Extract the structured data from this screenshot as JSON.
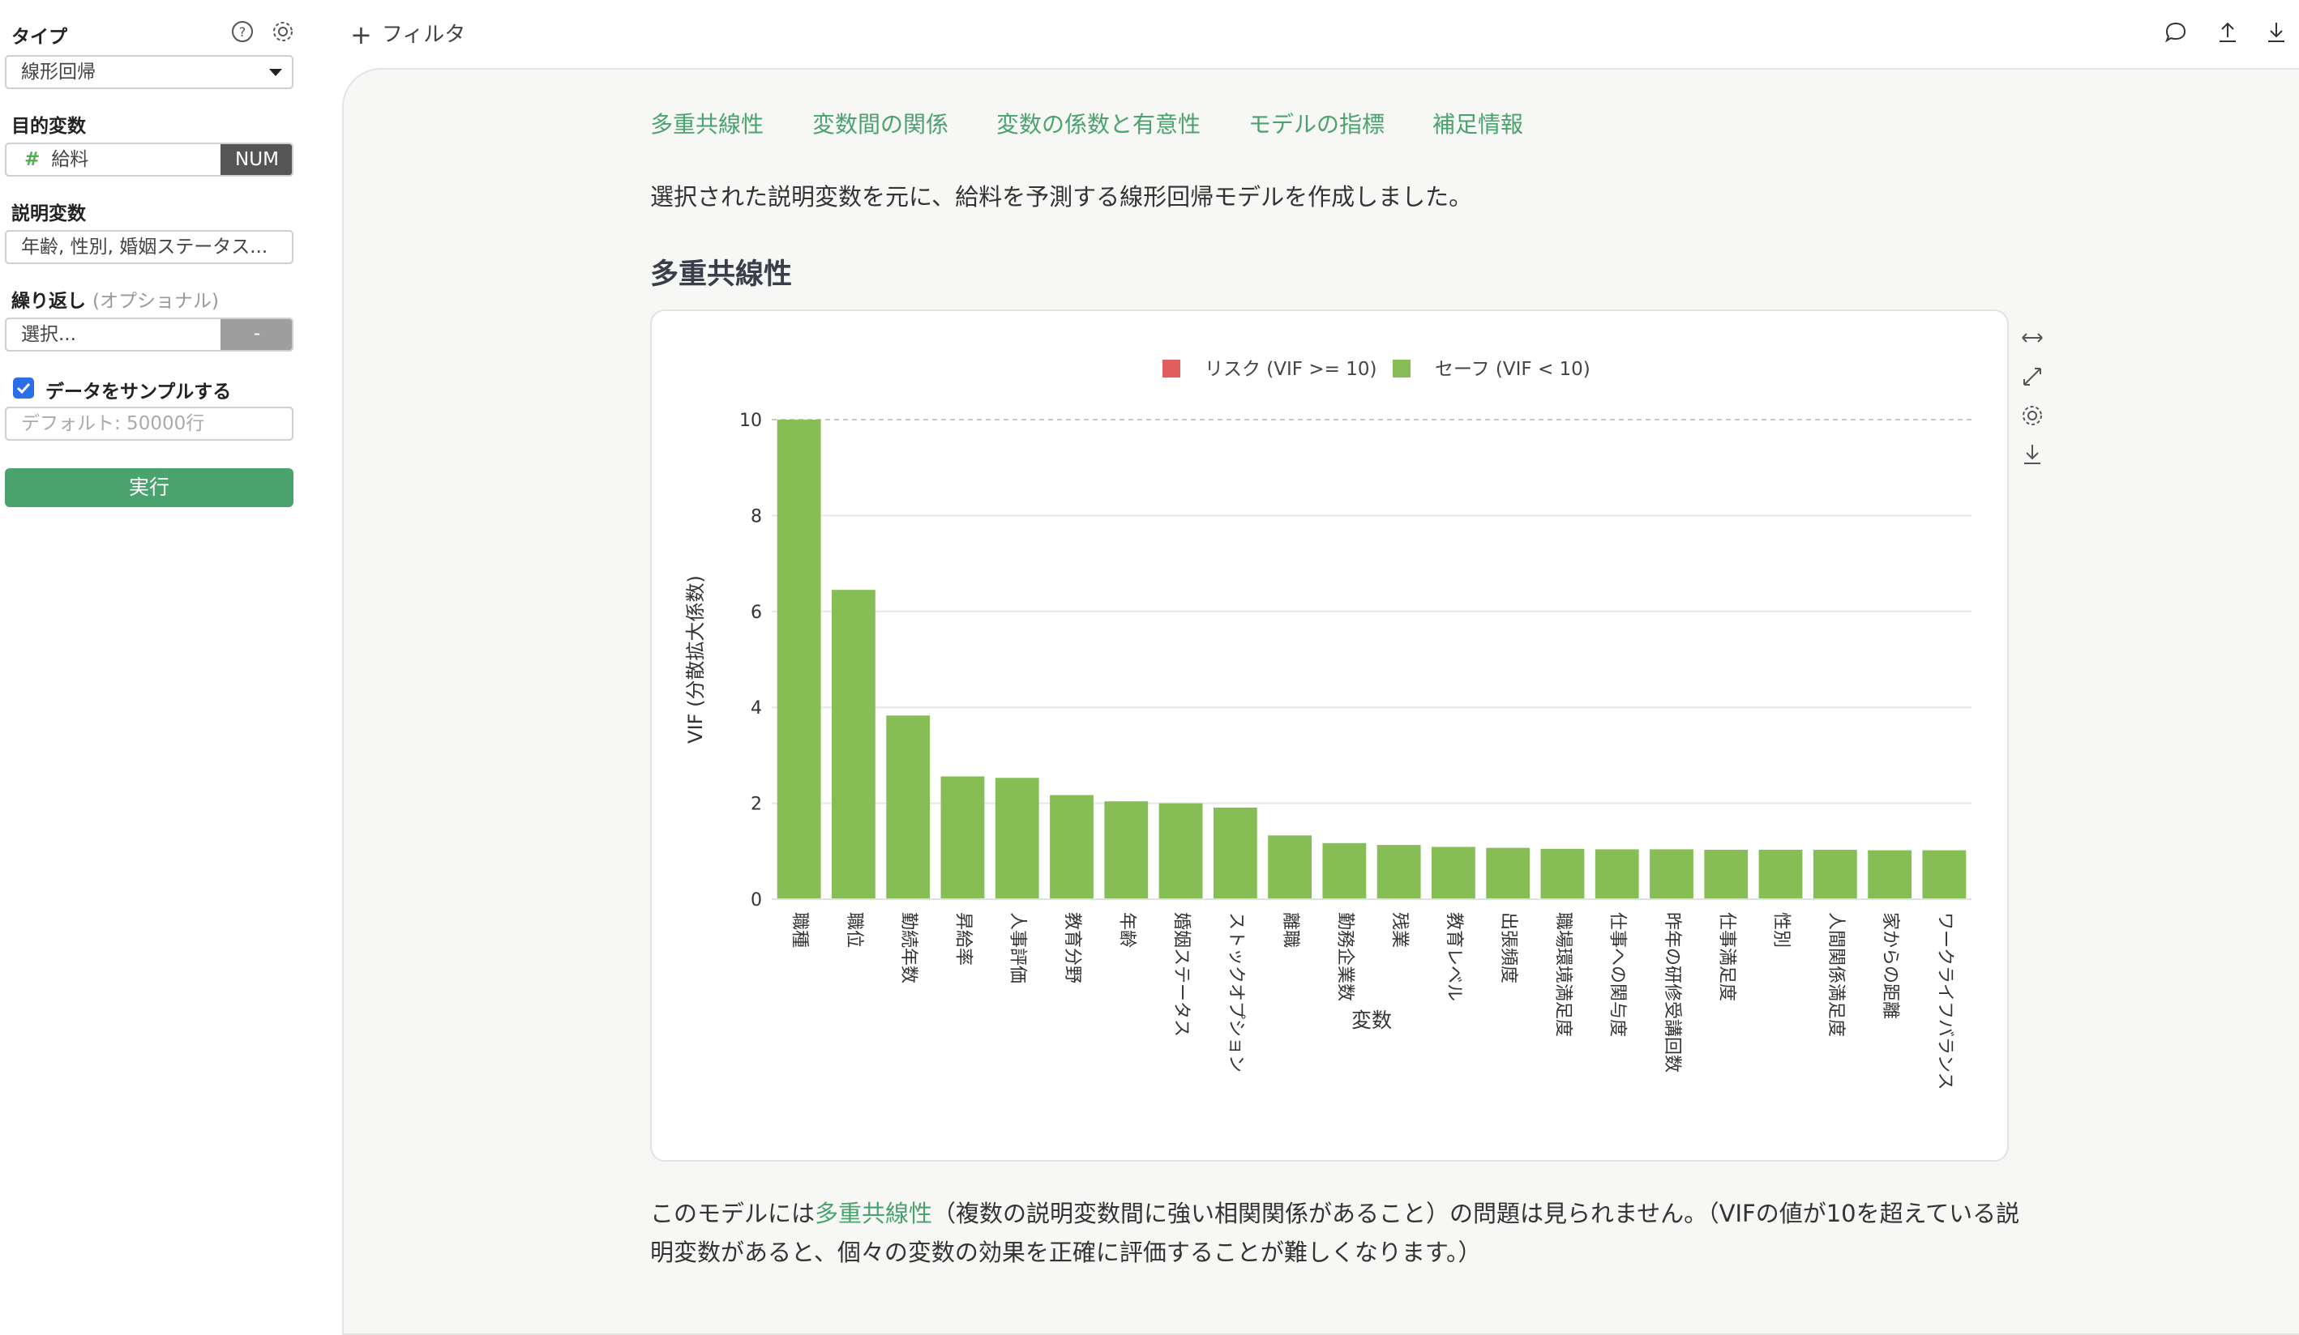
{
  "sidebar": {
    "type_label": "タイプ",
    "type_value": "線形回帰",
    "target_label": "目的変数",
    "target_value": "給料",
    "target_badge": "NUM",
    "explanatory_label": "説明変数",
    "explanatory_value": "年齢, 性別, 婚姻ステータス...",
    "repeat_label": "繰り返し",
    "repeat_optional": "(オプショナル)",
    "repeat_placeholder": "選択...",
    "repeat_button": "-",
    "sample_label": "データをサンプルする",
    "sample_checked": true,
    "sample_placeholder": "デフォルト: 50000行",
    "run_label": "実行"
  },
  "topbar": {
    "filter_label": "フィルタ",
    "icons": [
      "comment-icon",
      "upload-icon",
      "download-icon"
    ]
  },
  "tabs": [
    "多重共線性",
    "変数間の関係",
    "変数の係数と有意性",
    "モデルの指標",
    "補足情報"
  ],
  "intro": "選択された説明変数を元に、給料を予測する線形回帰モデルを作成しました。",
  "section_title": "多重共線性",
  "chart_tools": [
    "expand-horizontal-icon",
    "fullscreen-icon",
    "settings-icon",
    "download-icon"
  ],
  "chart_data": {
    "type": "bar",
    "legend": [
      {
        "name": "リスク (VIF >= 10)",
        "color": "#e05e5e"
      },
      {
        "name": "セーフ (VIF < 10)",
        "color": "#86bd55"
      }
    ],
    "legend_position": "top-center",
    "xlabel": "変数",
    "ylabel": "VIF (分散拡大係数)",
    "ylim": [
      0,
      10
    ],
    "yticks": [
      0,
      2,
      4,
      6,
      8,
      10
    ],
    "threshold": 10,
    "grid": true,
    "categories": [
      "職種",
      "職位",
      "勤続年数",
      "昇給率",
      "人事評価",
      "教育分野",
      "年齢",
      "婚姻ステータス",
      "ストックオプション",
      "離職",
      "勤務企業数",
      "残業",
      "教育レベル",
      "出張頻度",
      "職場環境満足度",
      "仕事への関与度",
      "昨年の研修受講回数",
      "仕事満足度",
      "性別",
      "人間関係満足度",
      "家からの距離",
      "ワークライフバランス"
    ],
    "values": [
      10.0,
      6.45,
      3.83,
      2.56,
      2.53,
      2.17,
      2.04,
      2.0,
      1.91,
      1.33,
      1.17,
      1.13,
      1.09,
      1.07,
      1.05,
      1.04,
      1.04,
      1.03,
      1.03,
      1.03,
      1.02,
      1.02
    ]
  },
  "footer": {
    "before": "このモデルには",
    "link": "多重共線性",
    "after": "（複数の説明変数間に強い相関関係があること）の問題は見られません。（VIFの値が10を超えている説明変数があると、個々の変数の効果を正確に評価することが難しくなります。）"
  }
}
